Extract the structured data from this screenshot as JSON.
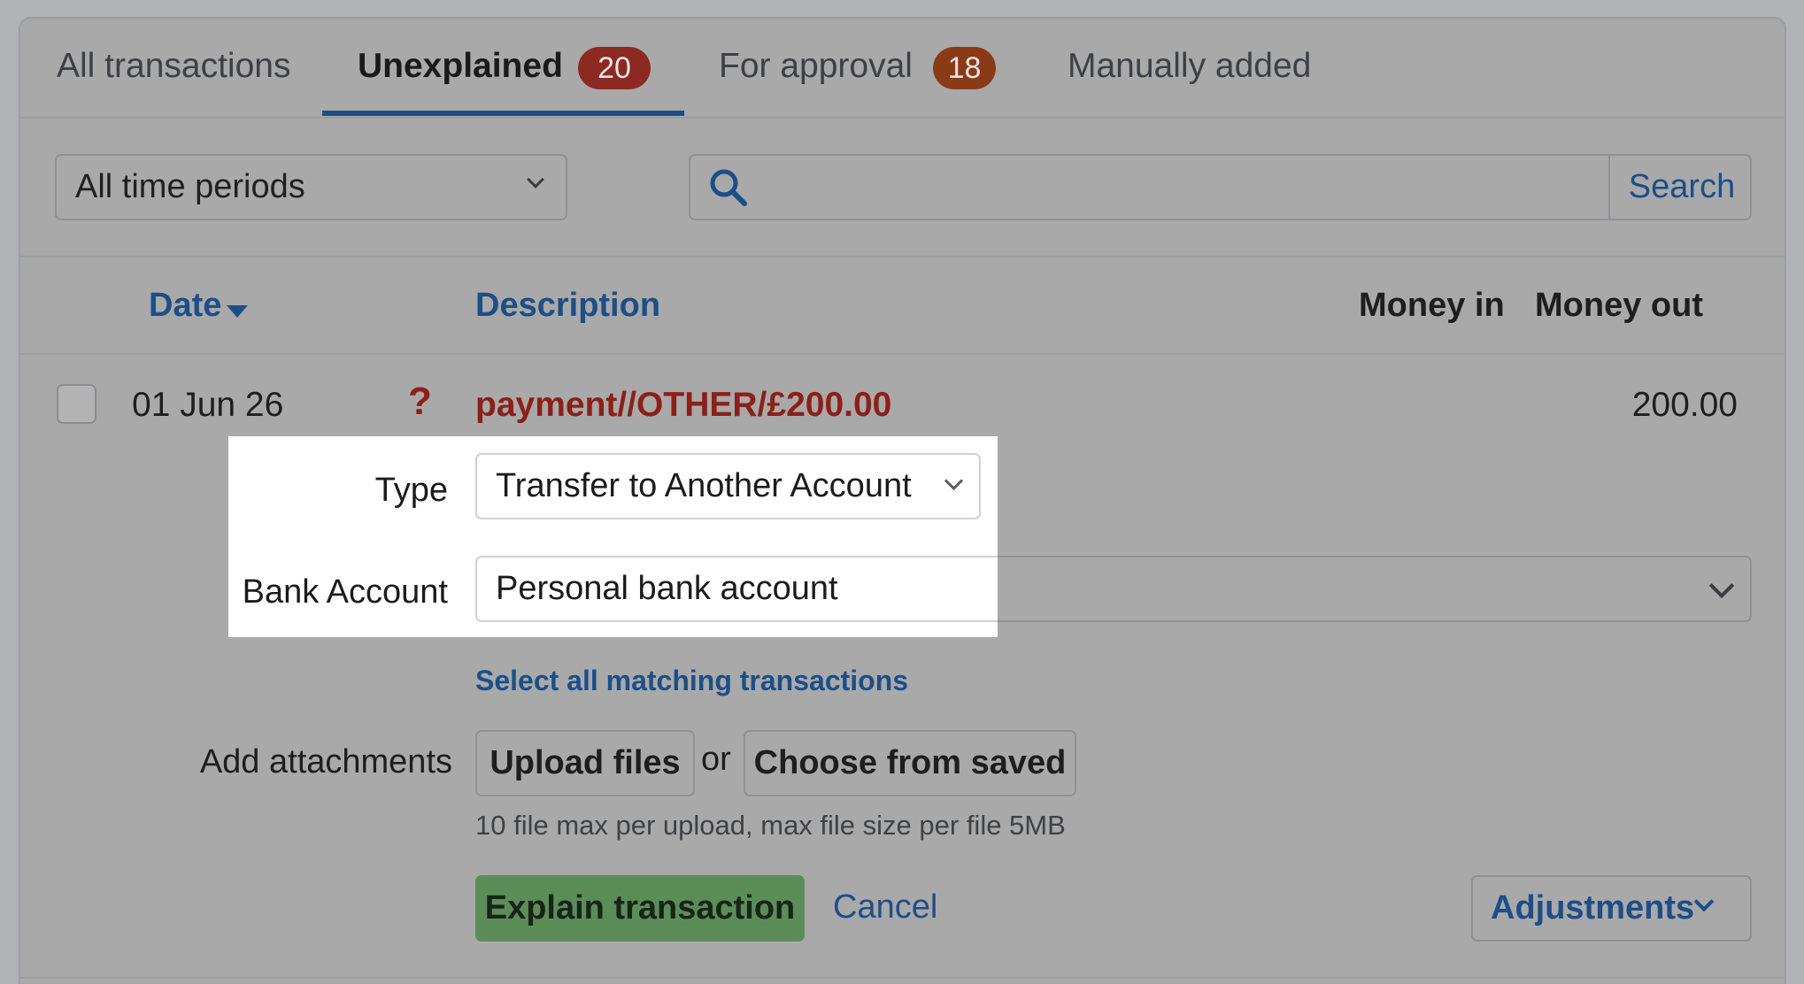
{
  "tabs": [
    {
      "label": "All transactions"
    },
    {
      "label": "Unexplained",
      "badge": "20"
    },
    {
      "label": "For approval",
      "badge": "18"
    },
    {
      "label": "Manually added"
    }
  ],
  "filters": {
    "period_value": "All time periods",
    "search_value": "",
    "search_button": "Search"
  },
  "columns": {
    "date": "Date",
    "description": "Description",
    "money_in": "Money in",
    "money_out": "Money out"
  },
  "row": {
    "date": "01 Jun 26",
    "status_glyph": "?",
    "description": "payment//OTHER/£200.00",
    "money_out": "200.00"
  },
  "form": {
    "type_label": "Type",
    "type_value": "Transfer to Another Account",
    "bank_label": "Bank Account",
    "bank_value": "Personal bank account",
    "select_matching": "Select all matching transactions",
    "attachments_label": "Add attachments",
    "upload_button": "Upload files",
    "or_text": "or",
    "choose_saved_button": "Choose from saved",
    "file_hint": "10 file max per upload, max file size per file 5MB",
    "explain_button": "Explain transaction",
    "cancel_link": "Cancel",
    "adjustments_button": "Adjustments"
  },
  "colors": {
    "badge_unexplained": "#8c2a22",
    "badge_approval": "#8a3a16",
    "accent_blue": "#1d4e87",
    "explain_green": "#5b8d58"
  }
}
